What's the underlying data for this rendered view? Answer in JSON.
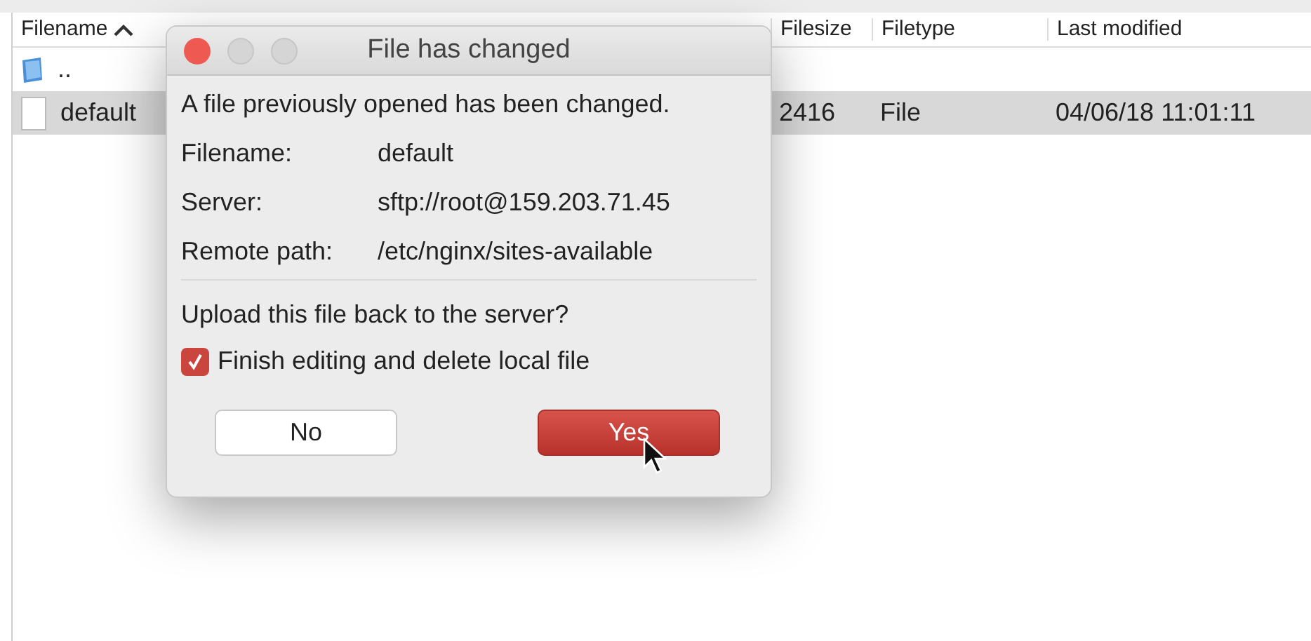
{
  "file_list": {
    "columns": [
      {
        "label": "Filename",
        "sorted": true
      },
      {
        "label": "Filesize",
        "sorted": false
      },
      {
        "label": "Filetype",
        "sorted": false
      },
      {
        "label": "Last modified",
        "sorted": false
      }
    ],
    "rows": [
      {
        "kind": "folder",
        "name": "..",
        "size": "",
        "type": "",
        "modified": "",
        "selected": false
      },
      {
        "kind": "file",
        "name": "default",
        "size": "2416",
        "type": "File",
        "modified": "04/06/18 11:01:11",
        "selected": true
      }
    ]
  },
  "dialog": {
    "title": "File has changed",
    "message": "A file previously opened has been changed.",
    "details": [
      {
        "label": "Filename:",
        "value": "default"
      },
      {
        "label": "Server:",
        "value": "sftp://root@159.203.71.45"
      },
      {
        "label": "Remote path:",
        "value": "/etc/nginx/sites-available"
      }
    ],
    "question": "Upload this file back to the server?",
    "checkbox": {
      "label": "Finish editing and delete local file",
      "checked": true
    },
    "buttons": [
      {
        "label": "No",
        "default": false
      },
      {
        "label": "Yes",
        "default": true
      }
    ]
  }
}
